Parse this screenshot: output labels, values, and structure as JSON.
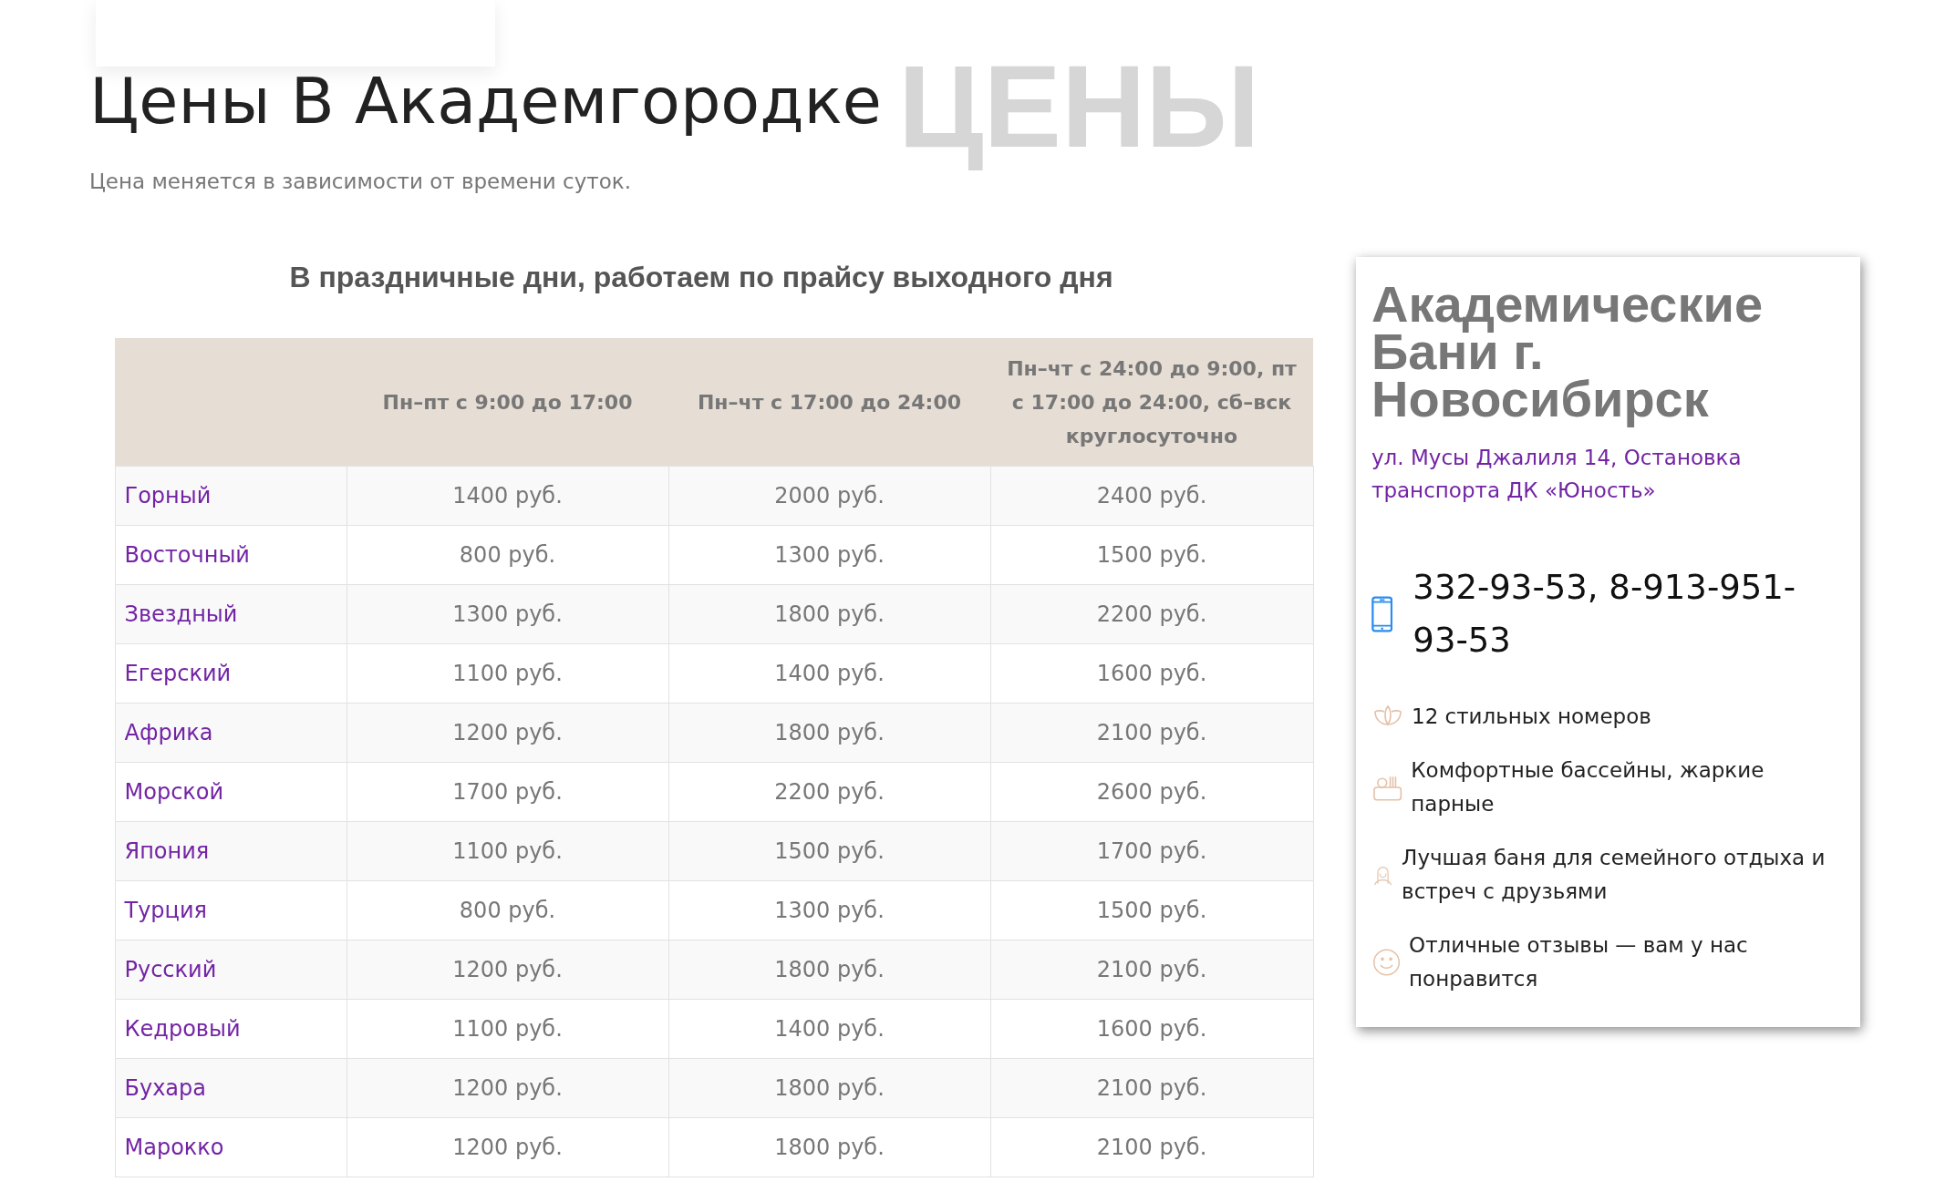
{
  "background_heading": "ЦЕНЫ",
  "title": "Цены В Академгородке",
  "subtitle": "Цена меняется в зависимости от времени суток.",
  "table_caption": "В праздничные дни, работаем по прайсу выходного дня",
  "table": {
    "columns": [
      "",
      "Пн–пт с 9:00 до 17:00",
      "Пн–чт с 17:00 до 24:00",
      "Пн–чт с 24:00 до 9:00, пт с 17:00 до 24:00, сб–вск круглосуточно"
    ],
    "rows": [
      {
        "name": "Горный",
        "prices": [
          "1400 руб.",
          "2000 руб.",
          "2400 руб."
        ]
      },
      {
        "name": "Восточный",
        "prices": [
          "800 руб.",
          "1300 руб.",
          "1500 руб."
        ]
      },
      {
        "name": "Звездный",
        "prices": [
          "1300 руб.",
          "1800 руб.",
          "2200 руб."
        ]
      },
      {
        "name": "Егерский",
        "prices": [
          "1100 руб.",
          "1400 руб.",
          "1600 руб."
        ]
      },
      {
        "name": "Африка",
        "prices": [
          "1200 руб.",
          "1800 руб.",
          "2100 руб."
        ]
      },
      {
        "name": "Морской",
        "prices": [
          "1700 руб.",
          "2200 руб.",
          "2600 руб."
        ]
      },
      {
        "name": "Япония",
        "prices": [
          "1100 руб.",
          "1500 руб.",
          "1700 руб."
        ]
      },
      {
        "name": "Турция",
        "prices": [
          "800 руб.",
          "1300 руб.",
          "1500 руб."
        ]
      },
      {
        "name": "Русский",
        "prices": [
          "1200 руб.",
          "1800 руб.",
          "2100 руб."
        ]
      },
      {
        "name": "Кедровый",
        "prices": [
          "1100 руб.",
          "1400 руб.",
          "1600 руб."
        ]
      },
      {
        "name": "Бухара",
        "prices": [
          "1200 руб.",
          "1800 руб.",
          "2100 руб."
        ]
      },
      {
        "name": "Марокко",
        "prices": [
          "1200 руб.",
          "1800 руб.",
          "2100 руб."
        ]
      }
    ]
  },
  "card": {
    "title": "Академические Бани  г. Новосибирск",
    "address": "ул. Мусы Джалиля 14,  Остановка транспорта ДК «Юность»",
    "phone": "332-93-53, 8-913-951-93-53",
    "features": [
      {
        "kind": "lotus",
        "text": "12 стильных номеров"
      },
      {
        "kind": "basket",
        "text": "Комфортные бассейны, жаркие парные"
      },
      {
        "kind": "person",
        "text": "Лучшая баня для семейного отдыха и встреч с друзьями"
      },
      {
        "kind": "smile",
        "text": "Отличные отзывы — вам у нас понравится"
      }
    ]
  }
}
